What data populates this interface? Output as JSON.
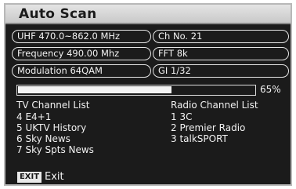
{
  "title": "Auto Scan",
  "info_left": [
    "UHF 470.0~862.0 MHz",
    "Frequency 490.00 Mhz",
    "Modulation  64QAM"
  ],
  "info_right": [
    "Ch No.  21",
    "FFT 8k",
    "GI 1/32"
  ],
  "progress": {
    "value": 65,
    "label": "65%"
  },
  "tv_list": {
    "header": "TV Channel List",
    "items": [
      "4  E4+1",
      "5  UKTV History",
      "6  Sky News",
      "7  Sky Spts News"
    ]
  },
  "radio_list": {
    "header": "Radio Channel List",
    "items": [
      "1 3C",
      "2 Premier Radio",
      "3 talkSPORT"
    ]
  },
  "footer": {
    "key": "EXIT",
    "label": "Exit"
  },
  "colors": {
    "panel": "#1b1b1b",
    "title_bar": "#d6d6d6",
    "text": "#f2f2f2",
    "progress_fill": "#f4f4f4"
  }
}
